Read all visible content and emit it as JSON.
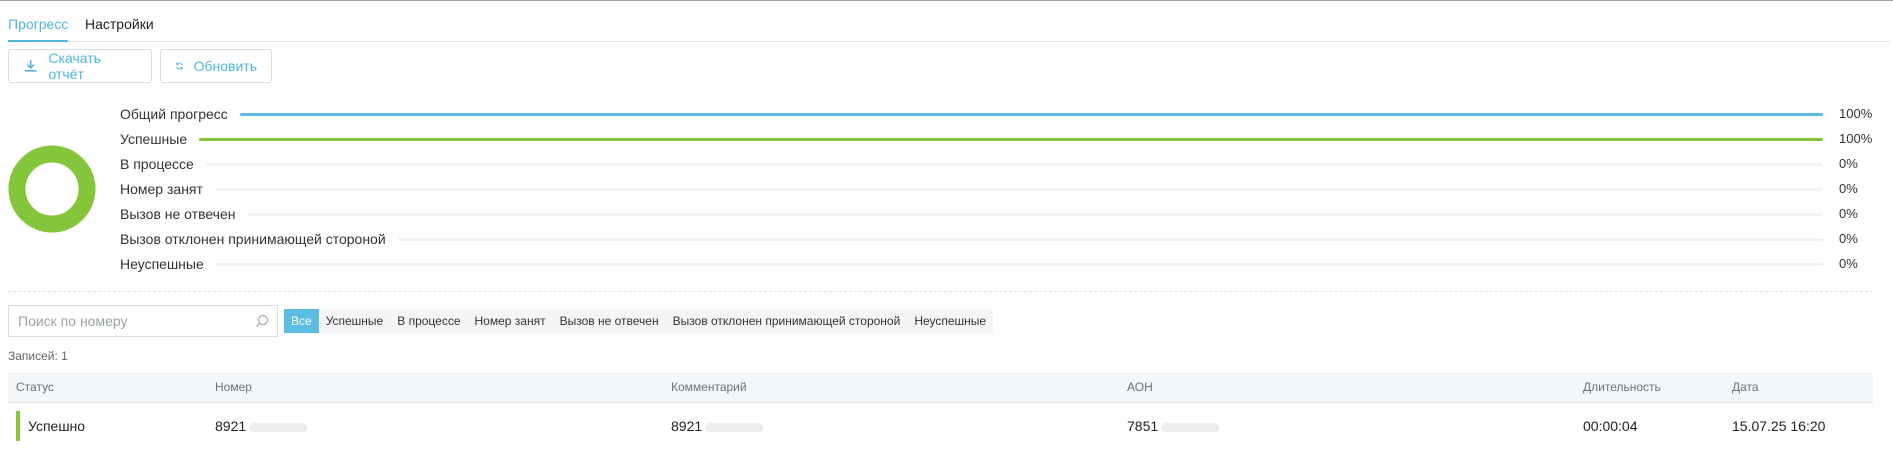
{
  "tabs": [
    {
      "label": "Прогресс",
      "active": true
    },
    {
      "label": "Настройки",
      "active": false
    }
  ],
  "toolbar": {
    "download_label": "Скачать отчёт",
    "refresh_label": "Обновить"
  },
  "colors": {
    "accent": "#4fb6dc",
    "success": "#85c53a",
    "track": "#f1f3f4"
  },
  "progress": {
    "donut": {
      "success_fraction": 1.0,
      "color": "#85c53a"
    },
    "rows": [
      {
        "label": "Общий прогресс",
        "percent": "100%",
        "value": 1.0,
        "color": "#5bbde3"
      },
      {
        "label": "Успешные",
        "percent": "100%",
        "value": 1.0,
        "color": "#85c53a"
      },
      {
        "label": "В процессе",
        "percent": "0%",
        "value": 0,
        "color": "#5bbde3"
      },
      {
        "label": "Номер занят",
        "percent": "0%",
        "value": 0,
        "color": "#f0a030"
      },
      {
        "label": "Вызов не отвечен",
        "percent": "0%",
        "value": 0,
        "color": "#f0a030"
      },
      {
        "label": "Вызов отклонен принимающей стороной",
        "percent": "0%",
        "value": 0,
        "color": "#e05050"
      },
      {
        "label": "Неуспешные",
        "percent": "0%",
        "value": 0,
        "color": "#e05050"
      }
    ]
  },
  "search": {
    "placeholder": "Поиск по номеру",
    "value": ""
  },
  "filters": [
    {
      "label": "Все",
      "active": true
    },
    {
      "label": "Успешные",
      "active": false
    },
    {
      "label": "В процессе",
      "active": false
    },
    {
      "label": "Номер занят",
      "active": false
    },
    {
      "label": "Вызов не отвечен",
      "active": false
    },
    {
      "label": "Вызов отклонен принимающей стороной",
      "active": false
    },
    {
      "label": "Неуспешные",
      "active": false
    }
  ],
  "records_label": "Записей: 1",
  "table": {
    "columns": [
      "Статус",
      "Номер",
      "Комментарий",
      "АОН",
      "Длительность",
      "Дата"
    ],
    "rows": [
      {
        "status": "Успешно",
        "number": "8921",
        "comment": "8921",
        "aon": "7851",
        "duration": "00:00:04",
        "date": "15.07.25 16:20"
      }
    ]
  }
}
